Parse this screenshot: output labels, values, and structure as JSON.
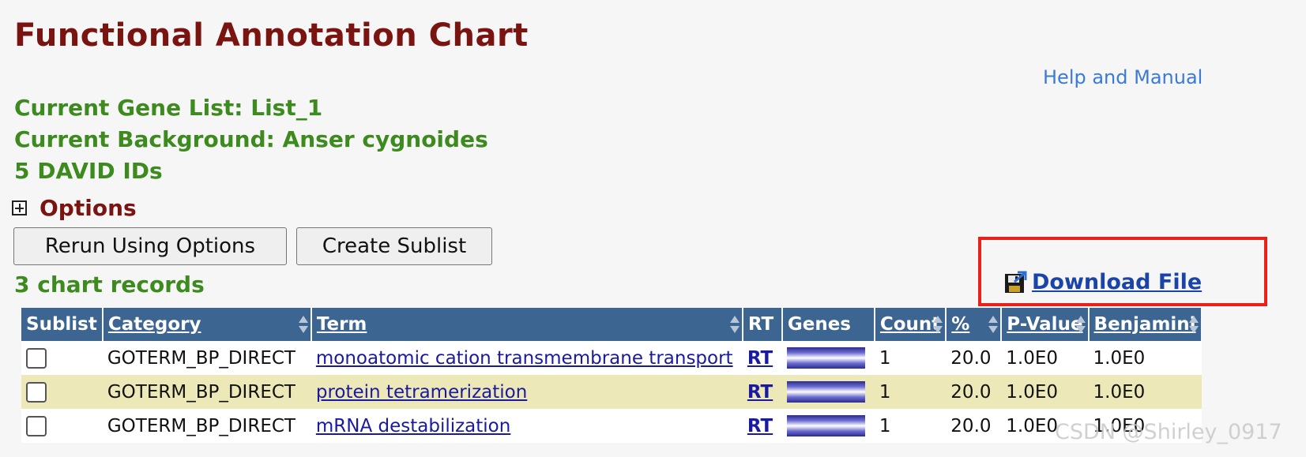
{
  "header": {
    "title": "Functional Annotation Chart",
    "help_link": "Help and Manual"
  },
  "info": {
    "gene_list": "Current Gene List: List_1",
    "background": "Current Background: Anser cygnoides",
    "david_ids": "5 DAVID IDs"
  },
  "options": {
    "label": "Options",
    "expand_icon": "plus-box-icon"
  },
  "buttons": {
    "rerun": "Rerun Using Options",
    "create_sublist": "Create Sublist"
  },
  "records": {
    "count_label": "3 chart records"
  },
  "download": {
    "label": "Download File",
    "icon": "floppy-disk-icon",
    "highlight_color": "#e8221b"
  },
  "table": {
    "columns": [
      "Sublist",
      "Category",
      "Term",
      "RT",
      "Genes",
      "Count",
      "%",
      "P-Value",
      "Benjamini"
    ],
    "rows": [
      {
        "category": "GOTERM_BP_DIRECT",
        "term": "monoatomic cation transmembrane transport",
        "rt": "RT",
        "count": "1",
        "percent": "20.0",
        "pvalue": "1.0E0",
        "benjamini": "1.0E0"
      },
      {
        "category": "GOTERM_BP_DIRECT",
        "term": "protein tetramerization",
        "rt": "RT",
        "count": "1",
        "percent": "20.0",
        "pvalue": "1.0E0",
        "benjamini": "1.0E0"
      },
      {
        "category": "GOTERM_BP_DIRECT",
        "term": "mRNA destabilization",
        "rt": "RT",
        "count": "1",
        "percent": "20.0",
        "pvalue": "1.0E0",
        "benjamini": "1.0E0"
      }
    ]
  },
  "colors": {
    "title": "#7a1410",
    "info_green": "#3d8a1e",
    "header_bg": "#3c6592",
    "row_highlight": "#ece8b8"
  },
  "watermark": "CSDN @Shirley_0917"
}
